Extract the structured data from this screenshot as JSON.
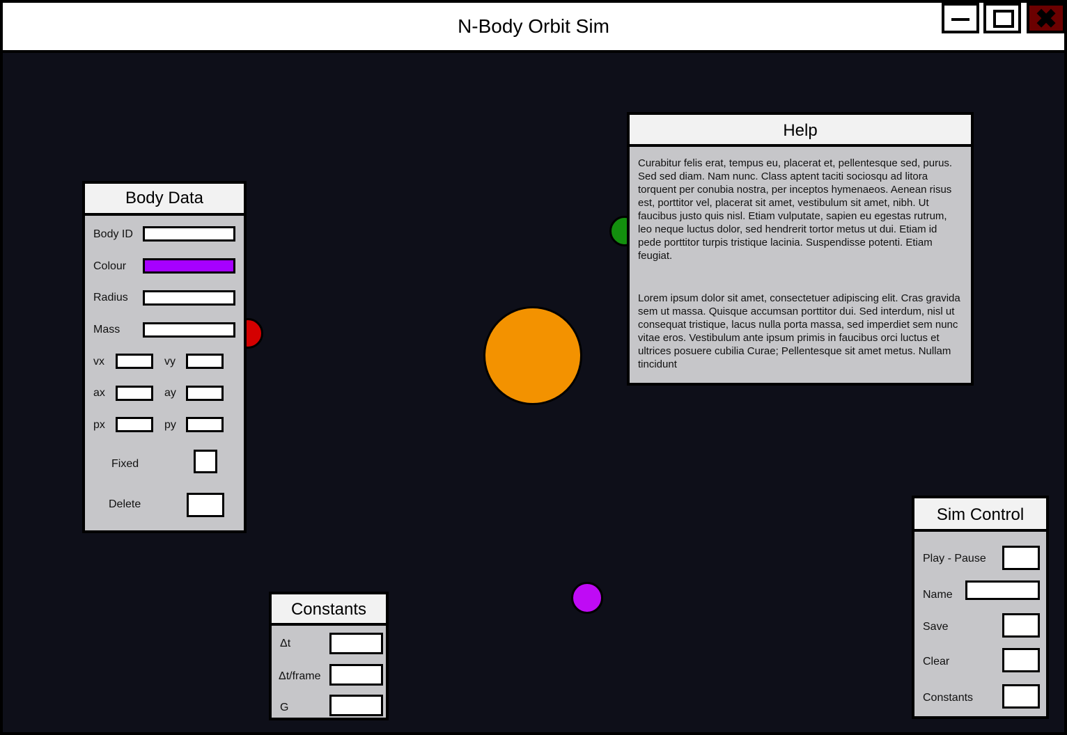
{
  "window": {
    "title": "N-Body Orbit Sim",
    "controls": {
      "minimize": "minimize-icon",
      "maximize": "maximize-icon",
      "close": "close-icon"
    },
    "close_color": "#6b0000",
    "background": "#0e0f19"
  },
  "bodies": [
    {
      "name": "central-star",
      "color": "#f39200"
    },
    {
      "name": "green-planet",
      "color": "#13900e"
    },
    {
      "name": "red-planet",
      "color": "#d40000"
    },
    {
      "name": "purple-planet",
      "color": "#bf0bf5"
    }
  ],
  "body_data": {
    "title": "Body Data",
    "body_id_label": "Body ID",
    "colour_label": "Colour",
    "colour_value": "#a600ff",
    "radius_label": "Radius",
    "mass_label": "Mass",
    "vx_label": "vx",
    "vy_label": "vy",
    "ax_label": "ax",
    "ay_label": "ay",
    "px_label": "px",
    "py_label": "py",
    "fixed_label": "Fixed",
    "delete_label": "Delete"
  },
  "help": {
    "title": "Help",
    "paragraph1": "Curabitur felis erat, tempus eu, placerat et, pellentesque sed, purus. Sed sed diam. Nam nunc. Class aptent taciti sociosqu ad litora torquent per conubia nostra, per inceptos hymenaeos. Aenean risus est, porttitor vel, placerat sit amet, vestibulum sit amet, nibh. Ut faucibus justo quis nisl. Etiam vulputate, sapien eu egestas rutrum, leo neque luctus dolor, sed hendrerit tortor metus ut dui. Etiam id pede porttitor turpis tristique lacinia. Suspendisse potenti. Etiam feugiat.",
    "paragraph2": "Lorem ipsum dolor sit amet, consectetuer adipiscing elit. Cras gravida sem ut massa. Quisque accumsan porttitor dui. Sed interdum, nisl ut consequat tristique, lacus nulla porta massa, sed imperdiet sem nunc vitae eros. Vestibulum ante ipsum primis in faucibus orci luctus et ultrices posuere cubilia Curae; Pellentesque sit amet metus. Nullam tincidunt"
  },
  "constants": {
    "title": "Constants",
    "dt_label": "Δt",
    "dt_frame_label": "Δt/frame",
    "g_label": "G"
  },
  "sim_control": {
    "title": "Sim Control",
    "play_pause_label": "Play - Pause",
    "name_label": "Name",
    "save_label": "Save",
    "clear_label": "Clear",
    "constants_label": "Constants"
  }
}
